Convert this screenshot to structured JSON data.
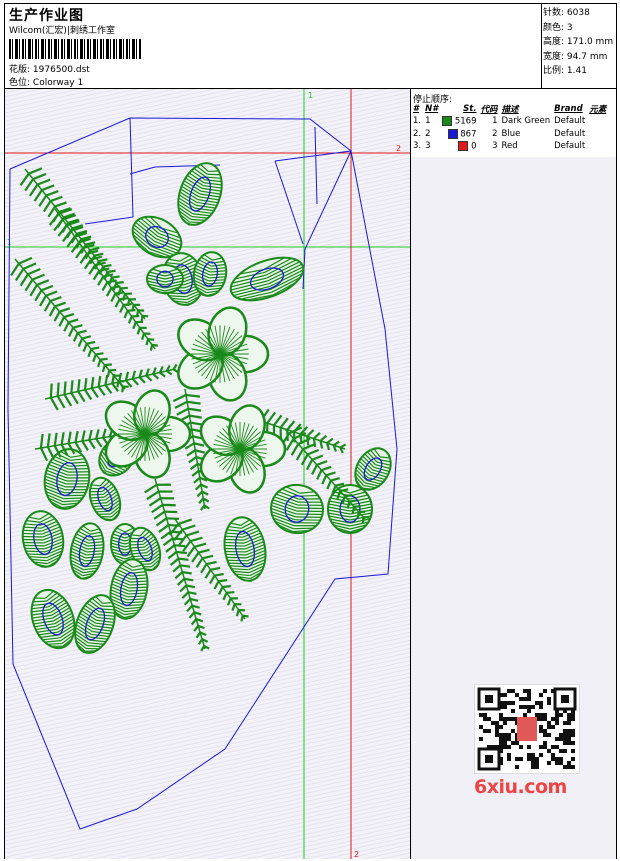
{
  "header": {
    "title": "生产作业图",
    "studio": "Wilcom(汇宏)|刺绣工作室",
    "pattern_label": "花版:",
    "pattern_value": "1976500.dst",
    "color_label": "色位:",
    "color_value": "Colorway 1"
  },
  "stats": {
    "stitches_label": "针数:",
    "stitches_value": "6038",
    "colors_label": "颜色:",
    "colors_value": "3",
    "height_label": "高度:",
    "height_value": "171.0 mm",
    "width_label": "宽度:",
    "width_value": "94.7 mm",
    "scale_label": "比例:",
    "scale_value": "1.41"
  },
  "stop_sequence": {
    "caption": "停止顺序:",
    "headers": [
      "#",
      "N#",
      "St.",
      "代码",
      "描述",
      "Brand",
      "元素"
    ],
    "rows": [
      {
        "index": "1.",
        "n": "1",
        "color": "#1a8a1a",
        "stitches": "5169",
        "code": "1",
        "desc": "Dark Green",
        "brand": "Default"
      },
      {
        "index": "2.",
        "n": "2",
        "color": "#1a1ad8",
        "stitches": "867",
        "code": "2",
        "desc": "Blue",
        "brand": "Default"
      },
      {
        "index": "3.",
        "n": "3",
        "color": "#e01818",
        "stitches": "0",
        "code": "3",
        "desc": "Red",
        "brand": "Default"
      }
    ]
  },
  "guides": {
    "green_label_top": "1",
    "green_label_left": "1",
    "red_label_right": "2",
    "red_label_bottom": "2"
  },
  "watermark": {
    "text": "6xiu.com"
  },
  "colors": {
    "thread_green": "#1a8a1a",
    "thread_blue": "#1a1ad8",
    "guide_red": "#e01818",
    "guide_green": "#22cc22"
  }
}
